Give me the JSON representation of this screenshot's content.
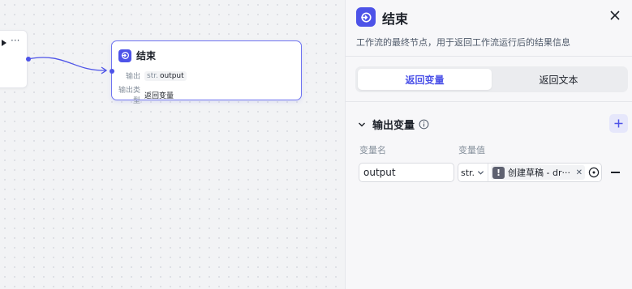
{
  "canvas": {
    "prev_node": {
      "more_label": "···"
    },
    "end_node": {
      "title": "结束",
      "output_row": {
        "key": "输出",
        "type_tag": "str.",
        "var": "output"
      },
      "type_row": {
        "key": "输出类型",
        "value": "返回变量"
      }
    }
  },
  "panel": {
    "title": "结束",
    "description": "工作流的最终节点，用于返回工作流运行后的结果信息",
    "tabs": [
      {
        "label": "返回变量",
        "active": true
      },
      {
        "label": "返回文本",
        "active": false
      }
    ],
    "output_section": {
      "title": "输出变量",
      "columns": {
        "name": "变量名",
        "value": "变量值"
      },
      "rows": [
        {
          "name": "output",
          "type": "str.",
          "reference": "创建草稿 - dr···",
          "warn_icon": "!"
        }
      ]
    }
  },
  "colors": {
    "accent": "#4d53e8",
    "border": "#e5e6eb"
  }
}
